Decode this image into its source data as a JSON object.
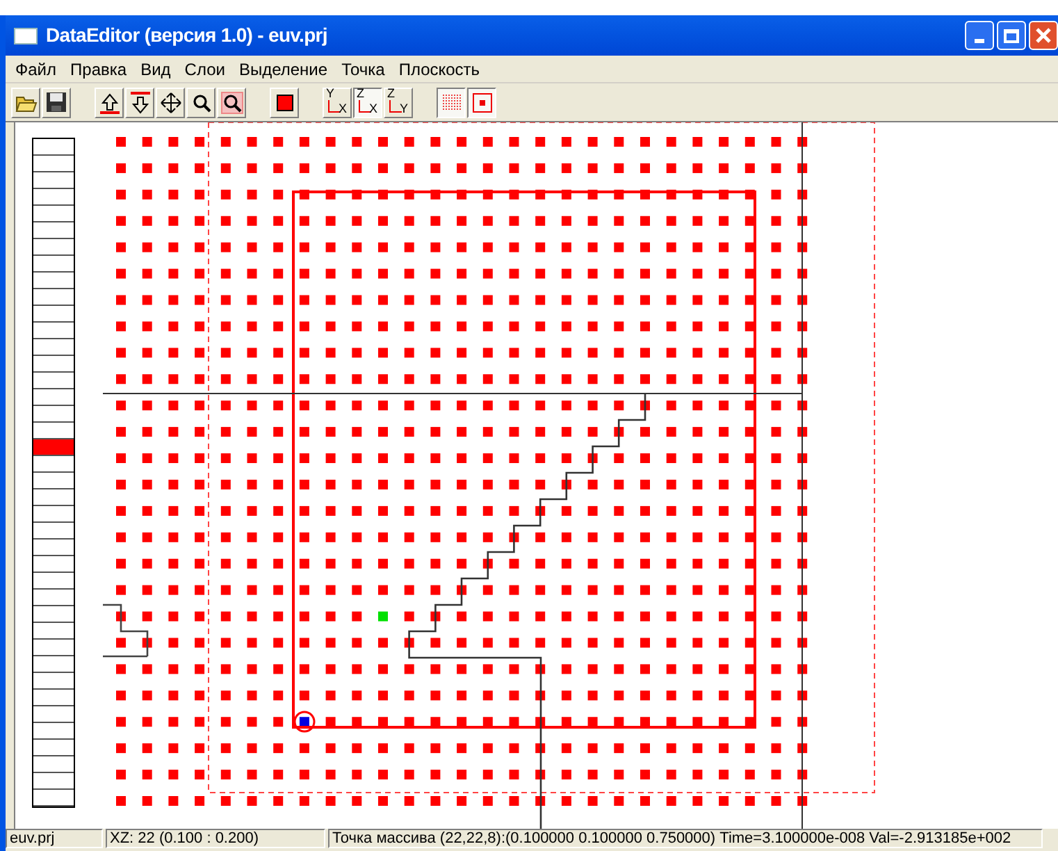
{
  "window": {
    "title": "DataEditor (версия 1.0) - euv.prj"
  },
  "menu": [
    "Файл",
    "Правка",
    "Вид",
    "Слои",
    "Выделение",
    "Точка",
    "Плоскость"
  ],
  "toolbar": [
    {
      "kind": "open"
    },
    {
      "kind": "save"
    },
    {
      "kind": "separator"
    },
    {
      "kind": "up"
    },
    {
      "kind": "down"
    },
    {
      "kind": "move"
    },
    {
      "kind": "zoom"
    },
    {
      "kind": "zoom-box"
    },
    {
      "kind": "separator"
    },
    {
      "kind": "color"
    },
    {
      "kind": "separator"
    },
    {
      "kind": "axis",
      "up": "Y",
      "right": "X",
      "selected": false
    },
    {
      "kind": "axis",
      "up": "Z",
      "right": "X",
      "selected": true
    },
    {
      "kind": "axis",
      "up": "Z",
      "right": "Y",
      "selected": false
    },
    {
      "kind": "separator"
    },
    {
      "kind": "grid",
      "selected": true
    },
    {
      "kind": "point",
      "selected": true
    }
  ],
  "layers": [
    {
      "selected": false
    },
    {
      "selected": false
    },
    {
      "selected": false
    },
    {
      "selected": false
    },
    {
      "selected": false
    },
    {
      "selected": false
    },
    {
      "selected": false
    },
    {
      "selected": false
    },
    {
      "selected": false
    },
    {
      "selected": false
    },
    {
      "selected": false
    },
    {
      "selected": false
    },
    {
      "selected": false
    },
    {
      "selected": false
    },
    {
      "selected": false
    },
    {
      "selected": false
    },
    {
      "selected": false
    },
    {
      "selected": false
    },
    {
      "selected": true
    },
    {
      "selected": false
    },
    {
      "selected": false
    },
    {
      "selected": false
    },
    {
      "selected": false
    },
    {
      "selected": false
    },
    {
      "selected": false
    },
    {
      "selected": false
    },
    {
      "selected": false
    },
    {
      "selected": false
    },
    {
      "selected": false
    },
    {
      "selected": false
    },
    {
      "selected": false
    },
    {
      "selected": false
    },
    {
      "selected": false
    },
    {
      "selected": false
    },
    {
      "selected": false
    },
    {
      "selected": false
    },
    {
      "selected": false
    },
    {
      "selected": false
    },
    {
      "selected": false
    },
    {
      "selected": false
    }
  ],
  "status_bar": [
    "euv.prj",
    "XZ: 22 (0.100 : 0.200)",
    "Точка массива (22,22,8):(0.100000 0.100000 0.750000) Time=3.100000e-008  Val=-2.913185e+002"
  ]
}
